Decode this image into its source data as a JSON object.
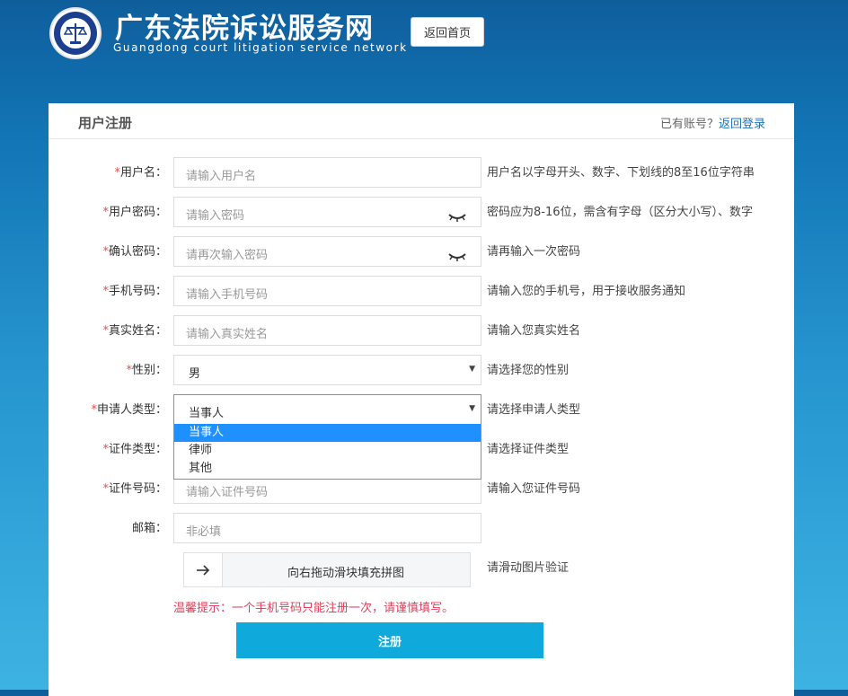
{
  "header": {
    "title_cn": "广东法院诉讼服务网",
    "title_en": "Guangdong court litigation service network",
    "home_button": "返回首页"
  },
  "card": {
    "title": "用户注册",
    "have_account": "已有账号？",
    "login_link": "返回登录"
  },
  "form": {
    "required_mark": "*",
    "username": {
      "label": "用户名：",
      "placeholder": "请输入用户名",
      "hint": "用户名以字母开头、数字、下划线的8至16位字符串"
    },
    "password": {
      "label": "用户密码：",
      "placeholder": "请输入密码",
      "hint": "密码应为8-16位，需含有字母（区分大小写）、数字"
    },
    "confirm": {
      "label": "确认密码：",
      "placeholder": "请再次输入密码",
      "hint": "请再输入一次密码"
    },
    "phone": {
      "label": "手机号码：",
      "placeholder": "请输入手机号码",
      "hint": "请输入您的手机号，用于接收服务通知"
    },
    "realname": {
      "label": "真实姓名：",
      "placeholder": "请输入真实姓名",
      "hint": "请输入您真实姓名"
    },
    "gender": {
      "label": "性别：",
      "value": "男",
      "hint": "请选择您的性别"
    },
    "applicant_type": {
      "label": "申请人类型：",
      "value": "当事人",
      "hint": "请选择申请人类型",
      "options": [
        "当事人",
        "律师",
        "其他"
      ]
    },
    "id_type": {
      "label": "证件类型：",
      "hint": "请选择证件类型"
    },
    "id_number": {
      "label": "证件号码：",
      "placeholder": "请输入证件号码",
      "hint": "请输入您证件号码"
    },
    "email": {
      "label": "邮箱：",
      "placeholder": "非必填"
    },
    "slider": {
      "text": "向右拖动滑块填充拼图",
      "hint": "请滑动图片验证"
    },
    "warning": "温馨提示：一个手机号码只能注册一次，请谨慎填写。",
    "submit": "注册"
  },
  "colors": {
    "accent": "#0fa9dc",
    "link": "#1a73b8",
    "warning": "#e0405a",
    "selected_option": "#1e90ff"
  }
}
